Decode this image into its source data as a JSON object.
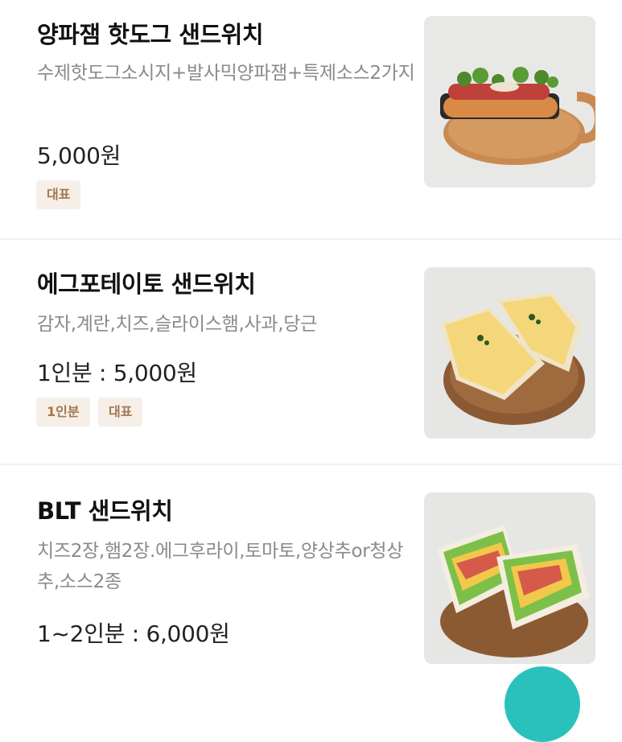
{
  "menu_items": [
    {
      "title": "양파잼 핫도그 샌드위치",
      "description": "수제핫도그소시지+발사믹양파잼+특제소스2가지",
      "price": "5,000원",
      "badges": [
        "대표"
      ],
      "image": "hotdog-sandwich-photo"
    },
    {
      "title": "에그포테이토 샌드위치",
      "description": "감자,계란,치즈,슬라이스햄,사과,당근",
      "price": "1인분 : 5,000원",
      "badges": [
        "1인분",
        "대표"
      ],
      "image": "egg-potato-sandwich-photo"
    },
    {
      "title": "BLT 샌드위치",
      "description": "치즈2장,햄2장.에그후라이,토마토,양상추or청상추,소스2종",
      "price": "1~2인분 : 6,000원",
      "badges": [],
      "image": "blt-sandwich-photo"
    }
  ],
  "colors": {
    "badge_bg": "#f5efe8",
    "badge_text": "#a4774d",
    "fab": "#2ac1bc",
    "divider": "#f1f1f1"
  },
  "floating_button": {
    "icon": "cart-icon"
  }
}
